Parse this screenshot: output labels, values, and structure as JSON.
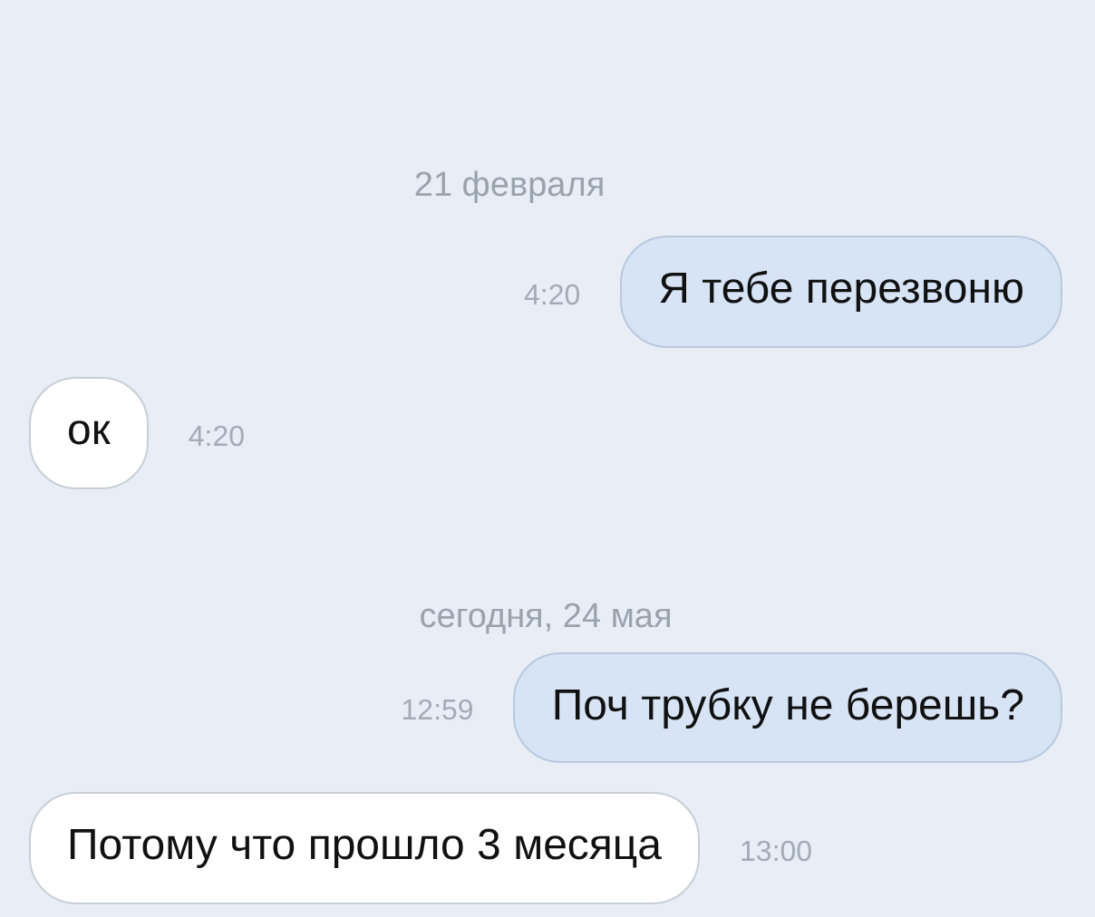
{
  "items": [
    {
      "kind": "date",
      "text": "21 февраля"
    },
    {
      "kind": "message",
      "outgoing": true,
      "text": "Я тебе перезвоню",
      "time": "4:20"
    },
    {
      "kind": "message",
      "outgoing": false,
      "text": "ок",
      "time": "4:20"
    },
    {
      "kind": "date",
      "text": "сегодня, 24 мая"
    },
    {
      "kind": "message",
      "outgoing": true,
      "text": "Поч трубку не берешь?",
      "time": "12:59"
    },
    {
      "kind": "message",
      "outgoing": false,
      "text": "Потому что прошло 3 месяца",
      "time": "13:00"
    }
  ]
}
